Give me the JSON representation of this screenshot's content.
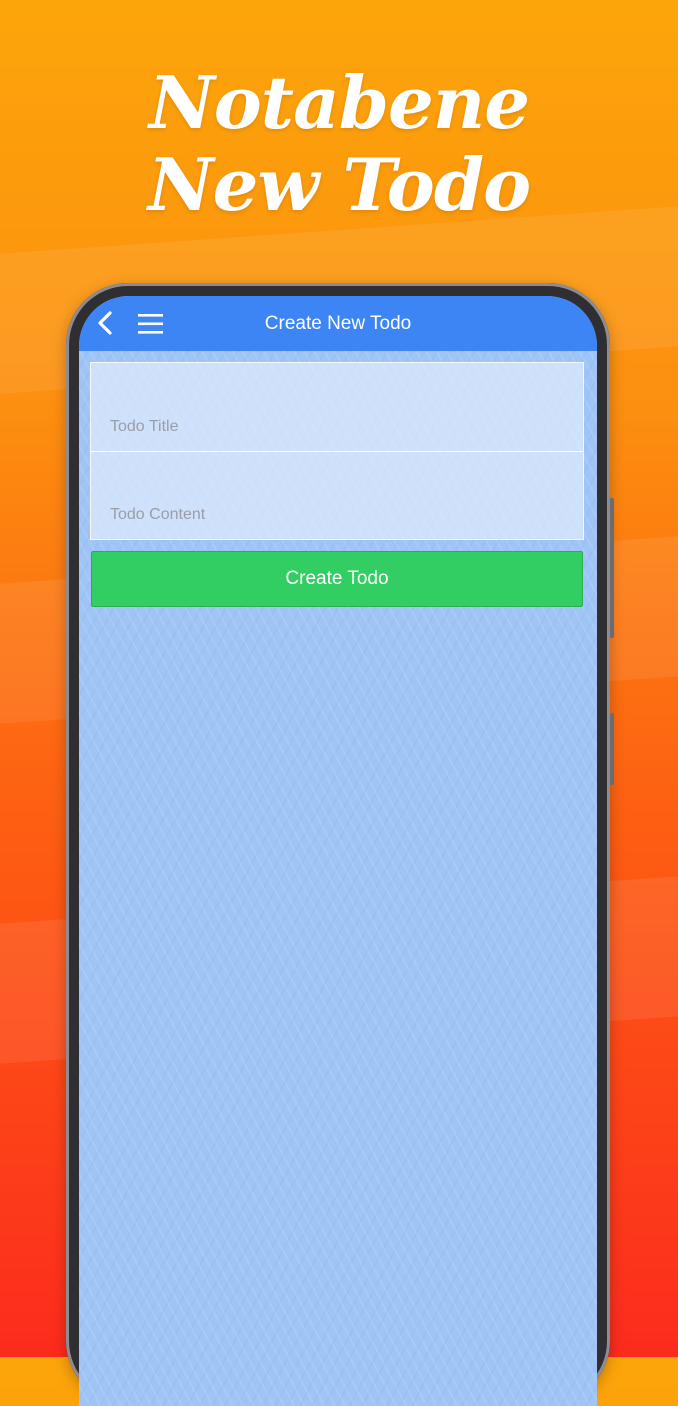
{
  "promo": {
    "title_line1": "Notabene",
    "title_line2": "New Todo"
  },
  "header": {
    "back_icon": "chevron-left-icon",
    "menu_icon": "hamburger-menu-icon",
    "title": "Create New Todo",
    "color": "#3d85f4"
  },
  "form": {
    "title_placeholder": "Todo Title",
    "title_value": "",
    "content_placeholder": "Todo Content",
    "content_value": ""
  },
  "actions": {
    "create_label": "Create Todo",
    "create_color": "#32cd63"
  }
}
